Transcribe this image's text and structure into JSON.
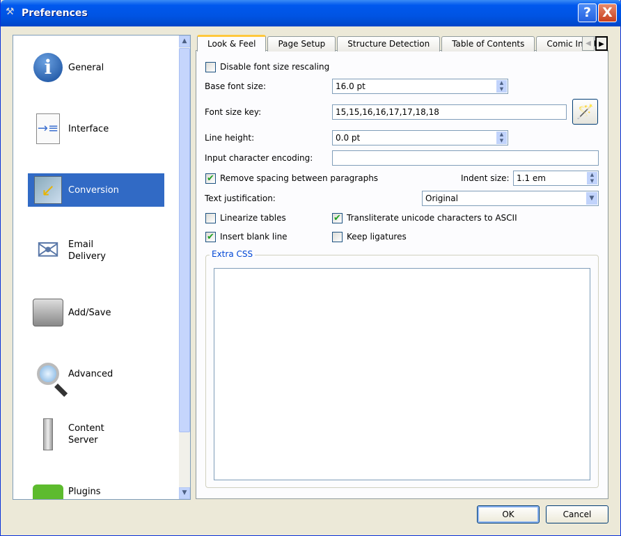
{
  "window": {
    "title": "Preferences",
    "help": "?",
    "close": "X"
  },
  "sidebar": {
    "items": [
      {
        "label": "General",
        "icon": "info-icon",
        "glyph": "ℹ"
      },
      {
        "label": "Interface",
        "icon": "interface-icon",
        "glyph": "☰"
      },
      {
        "label": "Conversion",
        "icon": "conversion-icon",
        "glyph": "📄",
        "selected": true
      },
      {
        "label": "Email\nDelivery",
        "label1": "Email",
        "label2": "Delivery",
        "icon": "email-icon",
        "glyph": "✉"
      },
      {
        "label": "Add/Save",
        "icon": "hard-drive-icon",
        "glyph": "🖴"
      },
      {
        "label": "Advanced",
        "icon": "magnifier-icon",
        "glyph": "🔍"
      },
      {
        "label1": "Content",
        "label2": "Server",
        "icon": "server-icon",
        "glyph": "▮"
      },
      {
        "label": "Plugins",
        "icon": "puzzle-icon",
        "glyph": "🧩"
      }
    ]
  },
  "tabs": [
    "Look & Feel",
    "Page Setup",
    "Structure Detection",
    "Table of Contents",
    "Comic Input"
  ],
  "form": {
    "disable_rescaling": {
      "label": "Disable font size rescaling",
      "checked": false
    },
    "base_font_size": {
      "label": "Base font size:",
      "value": "16.0 pt"
    },
    "font_size_key": {
      "label": "Font size key:",
      "value": "15,15,16,16,17,17,18,18"
    },
    "line_height": {
      "label": "Line height:",
      "value": "0.0 pt"
    },
    "encoding": {
      "label": "Input character encoding:",
      "value": ""
    },
    "remove_spacing": {
      "label": "Remove spacing between paragraphs",
      "checked": true
    },
    "indent_size": {
      "label": "Indent size:",
      "value": "1.1 em"
    },
    "text_justification": {
      "label": "Text justification:",
      "value": "Original"
    },
    "linearize_tables": {
      "label": "Linearize tables",
      "checked": false
    },
    "transliterate": {
      "label": "Transliterate unicode characters to ASCII",
      "checked": true
    },
    "insert_blank_line": {
      "label": "Insert blank line",
      "checked": true
    },
    "keep_ligatures": {
      "label": "Keep ligatures",
      "checked": false
    },
    "extra_css": {
      "label": "Extra CSS",
      "value": ""
    }
  },
  "buttons": {
    "ok": "OK",
    "cancel": "Cancel"
  },
  "check_glyph": "✔"
}
